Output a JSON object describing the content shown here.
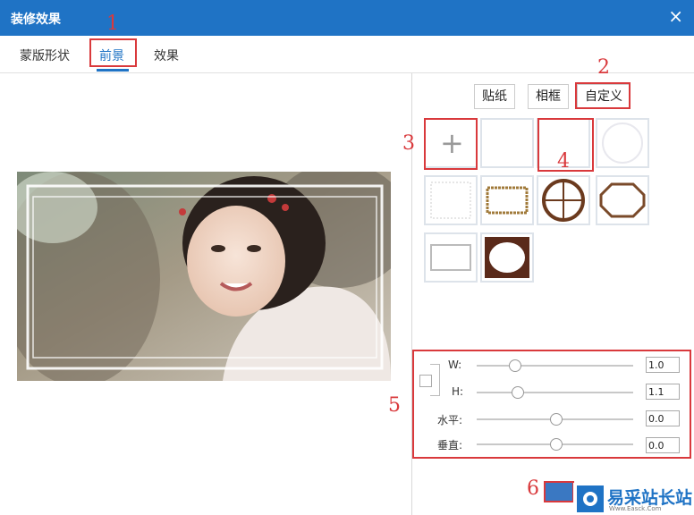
{
  "window": {
    "title": "装修效果",
    "close_icon": "×"
  },
  "tabs": [
    {
      "label": "蒙版形状",
      "active": false
    },
    {
      "label": "前景",
      "active": true
    },
    {
      "label": "效果",
      "active": false
    }
  ],
  "annotations": [
    "1",
    "2",
    "3",
    "4",
    "5",
    "6"
  ],
  "foreground": {
    "subtabs": [
      {
        "label": "贴纸",
        "active": false
      },
      {
        "label": "相框",
        "active": false
      },
      {
        "label": "自定义",
        "active": true
      }
    ],
    "thumbnails": [
      {
        "name": "add-custom"
      },
      {
        "name": "blank"
      },
      {
        "name": "blank-selected"
      },
      {
        "name": "circle-frame"
      },
      {
        "name": "stamp-frame"
      },
      {
        "name": "gold-rect-frame"
      },
      {
        "name": "round-window-frame"
      },
      {
        "name": "octagon-frame"
      },
      {
        "name": "plain-rect-frame"
      },
      {
        "name": "burnt-edge-frame"
      }
    ]
  },
  "controls": {
    "w_label": "W:",
    "w_value": "1.0",
    "w_level": 0.22,
    "h_label": "H:",
    "h_value": "1.1",
    "h_level": 0.24,
    "horizontal_label": "水平:",
    "horizontal_value": "0.0",
    "horizontal_level": 0.5,
    "vertical_label": "垂直:",
    "vertical_value": "0.0",
    "vertical_level": 0.5
  },
  "watermark": {
    "text": "易采站长站",
    "subtext": "Www.Easck.Com"
  },
  "colors": {
    "accent": "#1f73c5",
    "annotation": "#d9393c"
  }
}
